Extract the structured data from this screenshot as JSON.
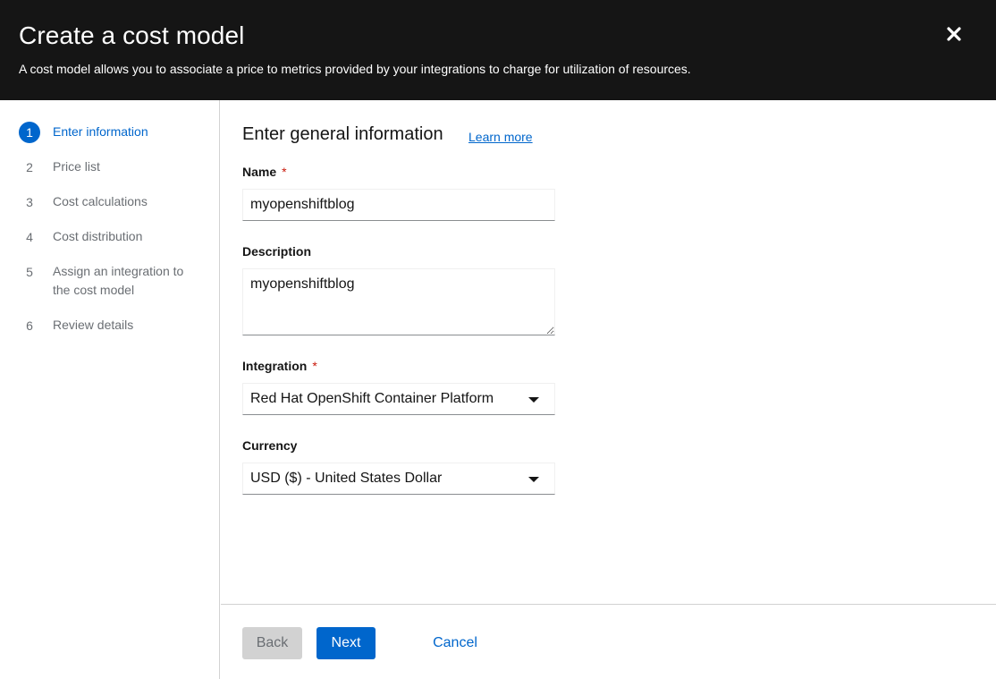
{
  "modal": {
    "title": "Create a cost model",
    "subtitle": "A cost model allows you to associate a price to metrics provided by your integrations to charge for utilization of resources.",
    "close_icon": "close-icon"
  },
  "steps": [
    {
      "number": "1",
      "label": "Enter information",
      "active": true
    },
    {
      "number": "2",
      "label": "Price list",
      "active": false
    },
    {
      "number": "3",
      "label": "Cost calculations",
      "active": false
    },
    {
      "number": "4",
      "label": "Cost distribution",
      "active": false
    },
    {
      "number": "5",
      "label": "Assign an integration to the cost model",
      "active": false
    },
    {
      "number": "6",
      "label": "Review details",
      "active": false
    }
  ],
  "form": {
    "section_title": "Enter general information",
    "learn_more": "Learn more",
    "required_mark": "*",
    "name": {
      "label": "Name",
      "value": "myopenshiftblog"
    },
    "description": {
      "label": "Description",
      "value": "myopenshiftblog"
    },
    "integration": {
      "label": "Integration",
      "value": "Red Hat OpenShift Container Platform"
    },
    "currency": {
      "label": "Currency",
      "value": "USD ($) - United States Dollar"
    }
  },
  "footer": {
    "back_label": "Back",
    "next_label": "Next",
    "cancel_label": "Cancel"
  },
  "colors": {
    "header_bg": "#151515",
    "accent": "#0066cc",
    "required": "#c9190b",
    "disabled_bg": "#d2d2d2"
  }
}
